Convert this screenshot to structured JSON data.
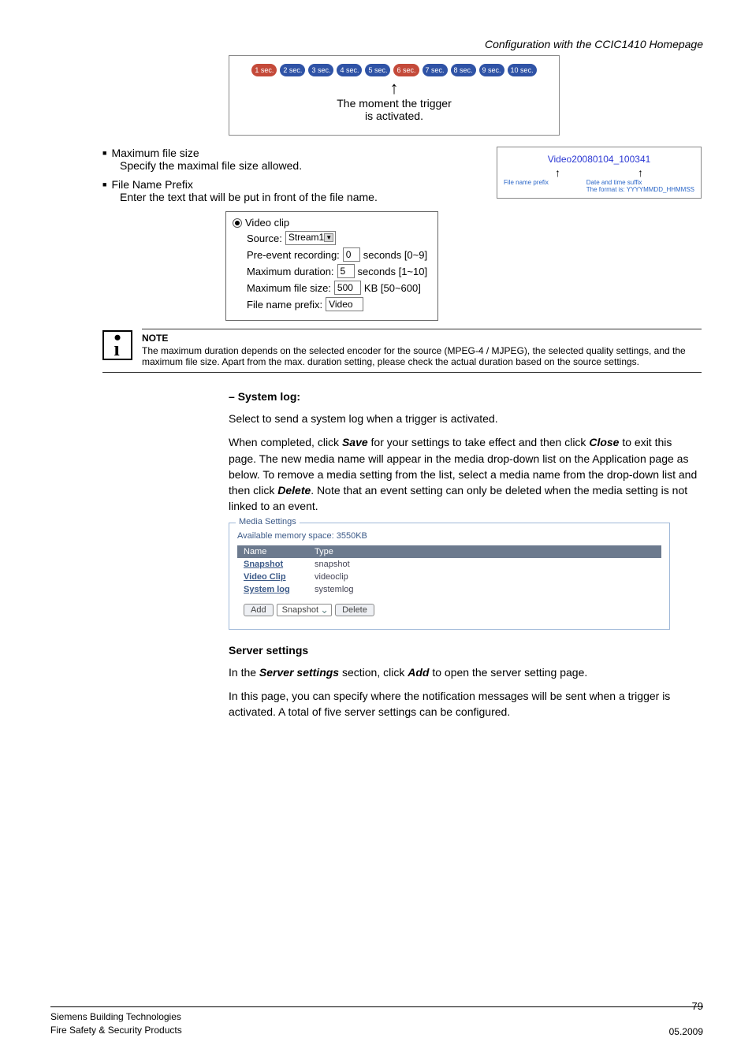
{
  "header": {
    "title": "Configuration with the CCIC1410 Homepage"
  },
  "diag1": {
    "labels": [
      "1 sec.",
      "2 sec.",
      "3 sec.",
      "4 sec.",
      "5 sec.",
      "6 sec.",
      "7 sec.",
      "8 sec.",
      "9 sec.",
      "10 sec."
    ],
    "colors": [
      "#c44a3a",
      "#2f53a6",
      "#2f53a6",
      "#2f53a6",
      "#2f53a6",
      "#c44a3a",
      "#2f53a6",
      "#2f53a6",
      "#2f53a6",
      "#2f53a6"
    ],
    "caption_line1": "The moment the trigger",
    "caption_line2": "is activated."
  },
  "bullets": {
    "max_size_title": "Maximum file size",
    "max_size_desc": "Specify the maximal file size allowed.",
    "prefix_title": "File Name Prefix",
    "prefix_desc": "Enter the text that will be put in front of the file name."
  },
  "filename_diag": {
    "video": "Video",
    "rest": "20080104_100341",
    "left_label": "File name prefix",
    "right_label1": "Date and time suffix",
    "right_label2": "The format is: YYYYMMDD_HHMMSS"
  },
  "videoclip": {
    "title": "Video clip",
    "source_label": "Source:",
    "source_value": "Stream1",
    "pre_label": "Pre-event recording:",
    "pre_value": "0",
    "pre_suffix": "seconds [0~9]",
    "maxdur_label": "Maximum duration:",
    "maxdur_value": "5",
    "maxdur_suffix": "seconds [1~10]",
    "maxsize_label": "Maximum file size:",
    "maxsize_value": "500",
    "maxsize_suffix": "KB [50~600]",
    "fnp_label": "File name prefix:",
    "fnp_value": "Video"
  },
  "note": {
    "title": "NOTE",
    "text": "The maximum duration depends on the selected encoder for the source (MPEG-4 / MJPEG), the selected quality settings, and the maximum file size. Apart from the max. duration setting, please check the actual duration based on the source settings."
  },
  "systemlog": {
    "heading": "System log:",
    "p1": "Select to send a system log when a trigger is activated.",
    "p2_a": "When completed, click ",
    "p2_save": "Save",
    "p2_b": " for your settings to take effect and then click ",
    "p2_close": "Close",
    "p2_c": " to exit this page. The new media name will appear in the media drop-down list on the Application page as below. To remove a media setting from the list, select a media name from the drop-down list and then click ",
    "p2_delete": "Delete",
    "p2_d": ". Note that an event setting can only be deleted when the media setting is not linked to an event."
  },
  "media": {
    "legend": "Media Settings",
    "avail": "Available memory space: 3550KB",
    "hdr_name": "Name",
    "hdr_type": "Type",
    "rows": [
      {
        "name": "Snapshot",
        "type": "snapshot"
      },
      {
        "name": "Video Clip",
        "type": "videoclip"
      },
      {
        "name": "System log",
        "type": "systemlog"
      }
    ],
    "btn_add": "Add",
    "sel_value": "Snapshot",
    "btn_delete": "Delete"
  },
  "server": {
    "heading": "Server settings",
    "p1_a": "In the ",
    "p1_em": "Server settings",
    "p1_b": " section, click ",
    "p1_add": "Add",
    "p1_c": " to open the server setting page.",
    "p2": "In this page, you can specify where the notification messages will be sent when a trigger is activated. A total of five server settings can be configured."
  },
  "footer": {
    "line1": "Siemens Building Technologies",
    "line2": "Fire Safety & Security Products",
    "date": "05.2009",
    "page": "79"
  }
}
